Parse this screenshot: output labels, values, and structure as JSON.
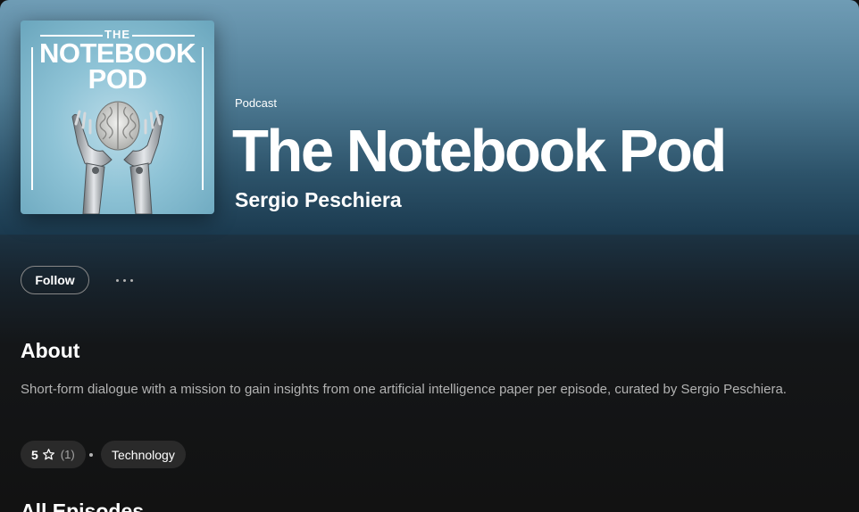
{
  "header": {
    "type_label": "Podcast",
    "title": "The Notebook Pod",
    "author": "Sergio Peschiera"
  },
  "cover": {
    "the_text": "THE",
    "title_line1": "NOTEBOOK",
    "title_line2": "POD",
    "image_icon": "robot-hands-holding-brain-icon"
  },
  "actions": {
    "follow_label": "Follow",
    "more_icon": "more-options-icon"
  },
  "about": {
    "heading": "About",
    "description": "Short-form dialogue with a mission to gain insights from one artificial intelligence paper per episode, curated by Sergio Peschiera.",
    "rating_value": "5",
    "rating_icon": "star-outline-icon",
    "rating_count": "(1)",
    "category": "Technology"
  },
  "episodes": {
    "heading": "All Episodes"
  },
  "colors": {
    "hero_top": "#6f9cb5",
    "hero_bottom": "#1b3a4f",
    "background": "#121212",
    "pill_bg": "#2a2a2a",
    "muted_text": "#b3b3b3"
  }
}
